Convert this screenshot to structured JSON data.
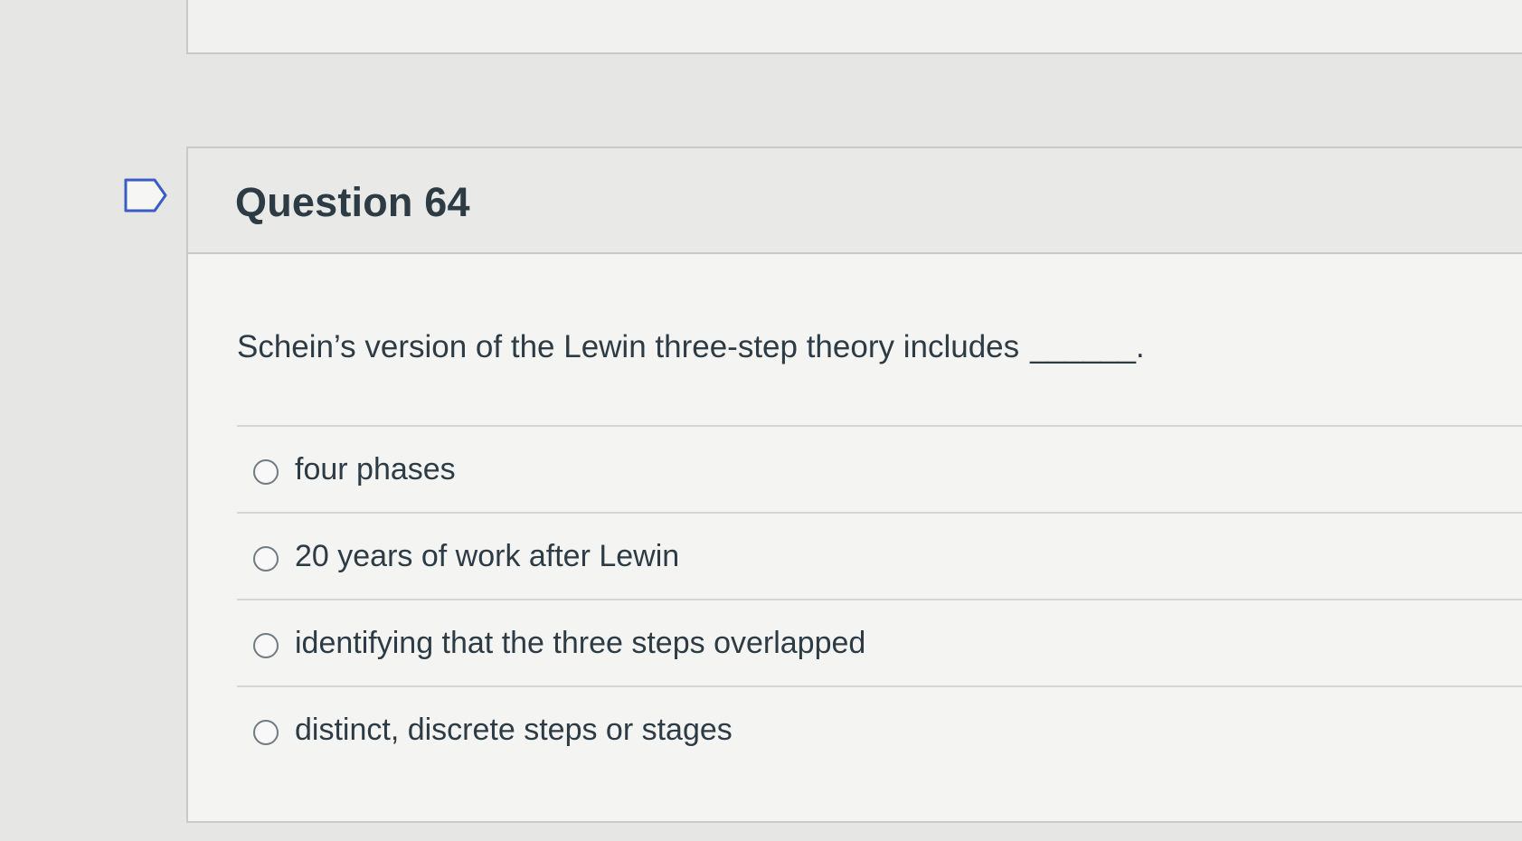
{
  "question": {
    "title": "Question 64",
    "text": "Schein’s version of the Lewin three-step theory includes",
    "blank": "______."
  },
  "icons": {
    "flag": "flag-question-icon"
  },
  "answers": [
    {
      "label": "four phases",
      "selected": false
    },
    {
      "label": "20 years of work after Lewin",
      "selected": false
    },
    {
      "label": "identifying that the three steps overlapped",
      "selected": false
    },
    {
      "label": "distinct, discrete steps or stages",
      "selected": false
    }
  ]
}
